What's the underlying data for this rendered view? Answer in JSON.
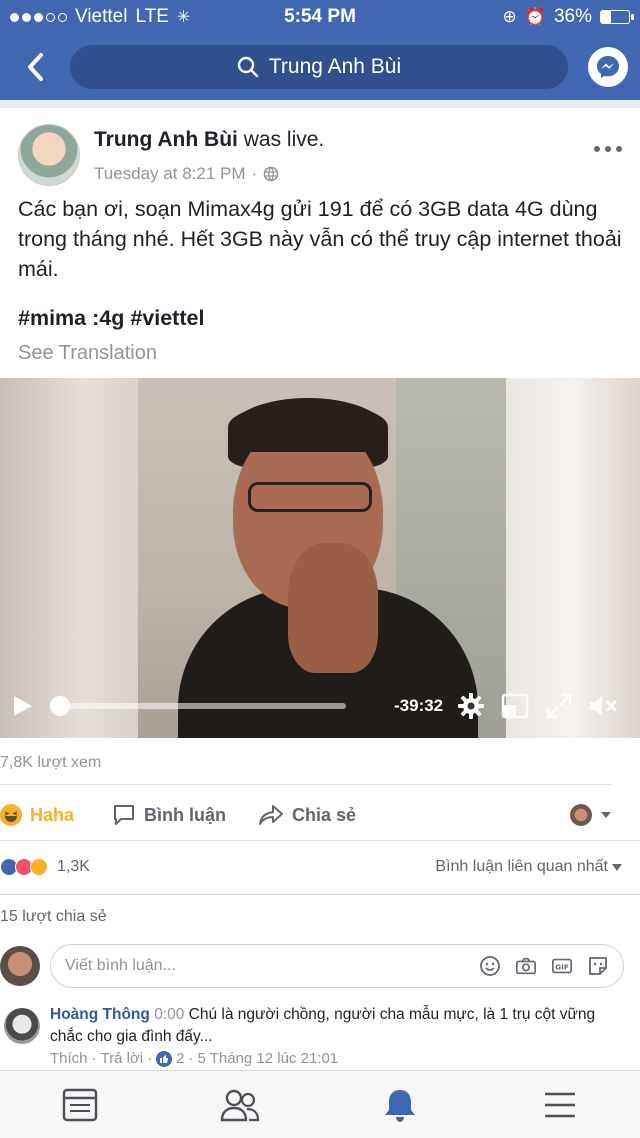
{
  "status_bar": {
    "carrier": "Viettel",
    "network": "LTE",
    "time": "5:54 PM",
    "battery": "36%",
    "battery_level": 0.36
  },
  "nav": {
    "search_text": "Trung Anh Bùi",
    "accent_color": "#4267b2"
  },
  "post": {
    "author": "Trung Anh Bùi",
    "action": "was live.",
    "timestamp": "Tuesday at 8:21 PM",
    "body": "Các bạn ơi, soạn Mimax4g gửi 191 để có 3GB data 4G dùng trong tháng nhé. Hết 3GB này vẫn có thể truy cập internet thoải mái.",
    "hashtags": "#mima :4g #viettel",
    "see_translation": "See Translation"
  },
  "video": {
    "time_remaining": "-39:32",
    "progress": 0.0
  },
  "stats": {
    "views": "7,8K lượt xem",
    "reaction_count": "1,3K",
    "sort_label": "Bình luận liên quan nhất",
    "shares": "15 lượt chia sẻ"
  },
  "actions": {
    "react_label": "Haha",
    "comment_label": "Bình luận",
    "share_label": "Chia sẻ"
  },
  "composer": {
    "placeholder": "Viết bình luận..."
  },
  "comment": {
    "name": "Hoàng Thông",
    "video_ts": "0:00",
    "text": "Chú là người chồng, người cha mẫu mực, là 1 trụ cột vững chắc cho gia đình đấy...",
    "like_label": "Thích",
    "reply_label": "Trả lời",
    "likes": "2",
    "date": "5 Tháng 12 lúc 21:01"
  },
  "tabbar": {
    "active_color": "#4267b2"
  }
}
